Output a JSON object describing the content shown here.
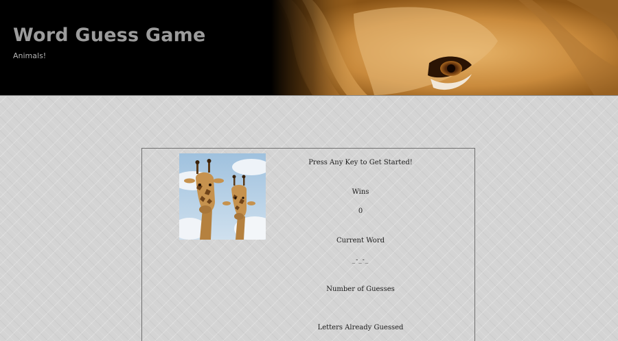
{
  "header": {
    "title": "Word Guess Game",
    "subtitle": "Animals!"
  },
  "game": {
    "prompt": "Press Any Key to Get Started!",
    "wins_label": "Wins",
    "wins_value": "0",
    "current_word_label": "Current Word",
    "current_word_value": "_-_-_",
    "guesses_label": "Number of Guesses",
    "letters_label": "Letters Already Guessed"
  },
  "images": {
    "banner": "lion-face-photo",
    "animal": "giraffes-photo"
  },
  "colors": {
    "header_bg": "#000000",
    "page_bg": "#d4d4d4",
    "title": "#9c9c9c",
    "panel_border": "#6e6e6e"
  }
}
